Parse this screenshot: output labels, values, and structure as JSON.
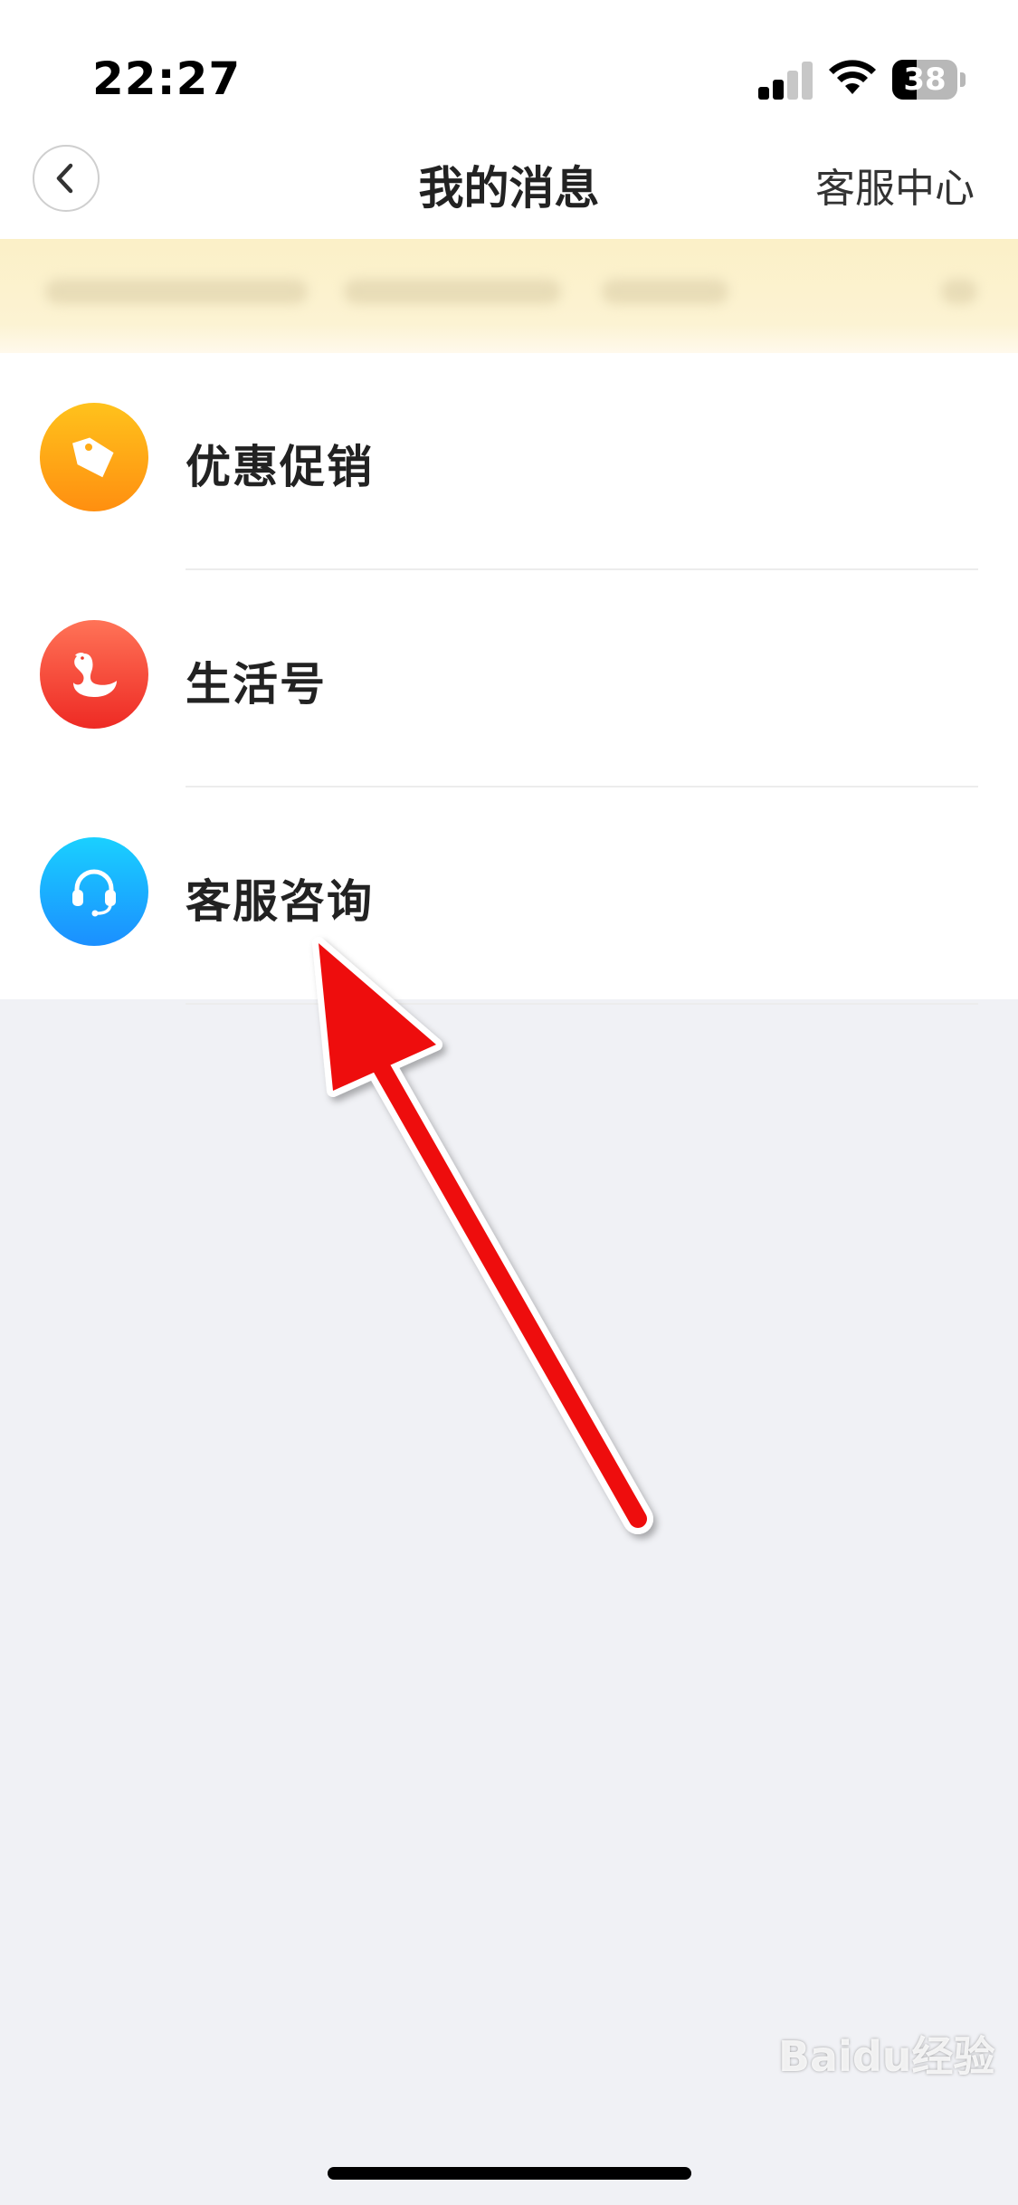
{
  "status_bar": {
    "time": "22:27",
    "battery_level": "38",
    "battery_percent": 38
  },
  "nav": {
    "back_icon": "chevron-left-icon",
    "title": "我的消息",
    "right_label": "客服中心"
  },
  "messages": [
    {
      "label": "优惠促销",
      "icon": "price-tag-icon",
      "color_from": "#ffc21c",
      "color_to": "#ff8f10"
    },
    {
      "label": "生活号",
      "icon": "swan-icon",
      "color_from": "#ff7357",
      "color_to": "#ee2a24"
    },
    {
      "label": "客服咨询",
      "icon": "headset-icon",
      "color_from": "#1ad0ff",
      "color_to": "#1b8fff"
    }
  ],
  "annotation": {
    "arrow_color": "#ee1111"
  },
  "watermark": {
    "text": "Baidu经验"
  }
}
